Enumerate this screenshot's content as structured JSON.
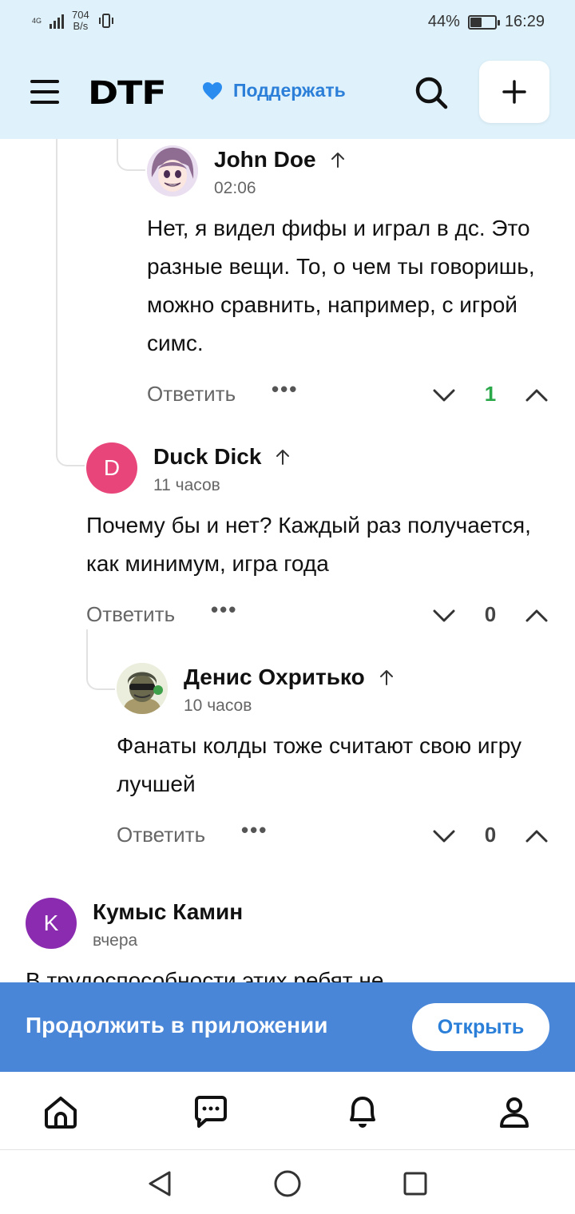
{
  "status_bar": {
    "network": "4G",
    "speed_value": "704",
    "speed_unit": "B/s",
    "battery": "44%",
    "battery_level": 0.44,
    "time": "16:29"
  },
  "header": {
    "logo": "DTF",
    "support_label": "Поддержать",
    "support_color": "#2b7fd8"
  },
  "comments": [
    {
      "author": "John Doe",
      "time": "02:06",
      "avatar_icon": "anime-girl-avatar",
      "text": "Нет, я видел фифы и играл в дс. Это разные вещи. То, о чем ты говоришь, можно сравнить, например, с игрой симс.",
      "reply_label": "Ответить",
      "more_label": "•••",
      "votes": "1",
      "votes_color": "#2aa84a"
    },
    {
      "author": "Duck Dick",
      "time": "11 часов",
      "avatar_letter": "D",
      "avatar_color": "#e8457a",
      "text": "Почему бы и нет? Каждый раз получается, как минимум, игра года",
      "reply_label": "Ответить",
      "more_label": "•••",
      "votes": "0"
    },
    {
      "author": "Денис Охритько",
      "time": "10 часов",
      "avatar_icon": "soldier-avatar",
      "text": "Фанаты колды тоже считают свою игру лучшей",
      "reply_label": "Ответить",
      "more_label": "•••",
      "votes": "0"
    },
    {
      "author": "Кумыс Камин",
      "time": "вчера",
      "avatar_letter": "K",
      "avatar_color": "#8a2bb0",
      "text": "В трудоспособности этих ребят не"
    }
  ],
  "continue_banner": {
    "text": "Продолжить в приложении",
    "button": "Открыть",
    "color": "#4a86d8"
  },
  "bottom_nav": [
    "home-icon",
    "chat-icon",
    "bell-icon",
    "profile-icon"
  ],
  "system_nav": [
    "back-icon",
    "home-circle-icon",
    "recents-icon"
  ]
}
